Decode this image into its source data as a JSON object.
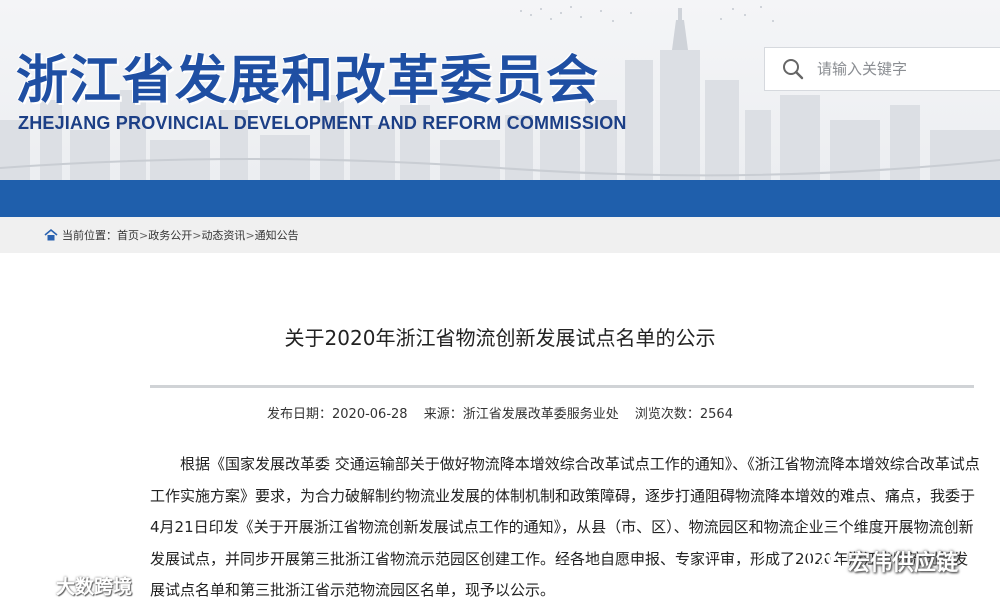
{
  "header": {
    "title": "浙江省发展和改革委员会",
    "subtitle": "ZHEJIANG PROVINCIAL DEVELOPMENT AND REFORM COMMISSION",
    "search_placeholder": "请输入关键字"
  },
  "breadcrumb": {
    "prefix": "当前位置：",
    "items": [
      "首页",
      "政务公开",
      "动态资讯",
      "通知公告"
    ],
    "separator": ">"
  },
  "article": {
    "title": "关于2020年浙江省物流创新发展试点名单的公示",
    "publish_date": "发布日期：2020-06-28",
    "source": "来源：浙江省发展改革委服务业处",
    "views": "浏览次数：2564",
    "paragraph": "根据《国家发展改革委 交通运输部关于做好物流降本增效综合改革试点工作的通知》、《浙江省物流降本增效综合改革试点工作实施方案》要求，为合力破解制约物流业发展的体制机制和政策障碍，逐步打通阻碍物流降本增效的难点、痛点，我委于4月21日印发《关于开展浙江省物流创新发展试点工作的通知》，从县（市、区）、物流园区和物流企业三个维度开展物流创新发展试点，并同步开展第三批浙江省物流示范园区创建工作。经各地自愿申报、专家评审，形成了2020年浙江省物流创新发展试点名单和第三批浙江省示范物流园区名单，现予以公示。"
  },
  "watermarks": {
    "left": "大数跨境",
    "right": "宏伟供应链"
  },
  "colors": {
    "title_blue": "#1f4fa3",
    "band_blue": "#1f5fac",
    "breadcrumb_bg": "#f0f0f0"
  }
}
